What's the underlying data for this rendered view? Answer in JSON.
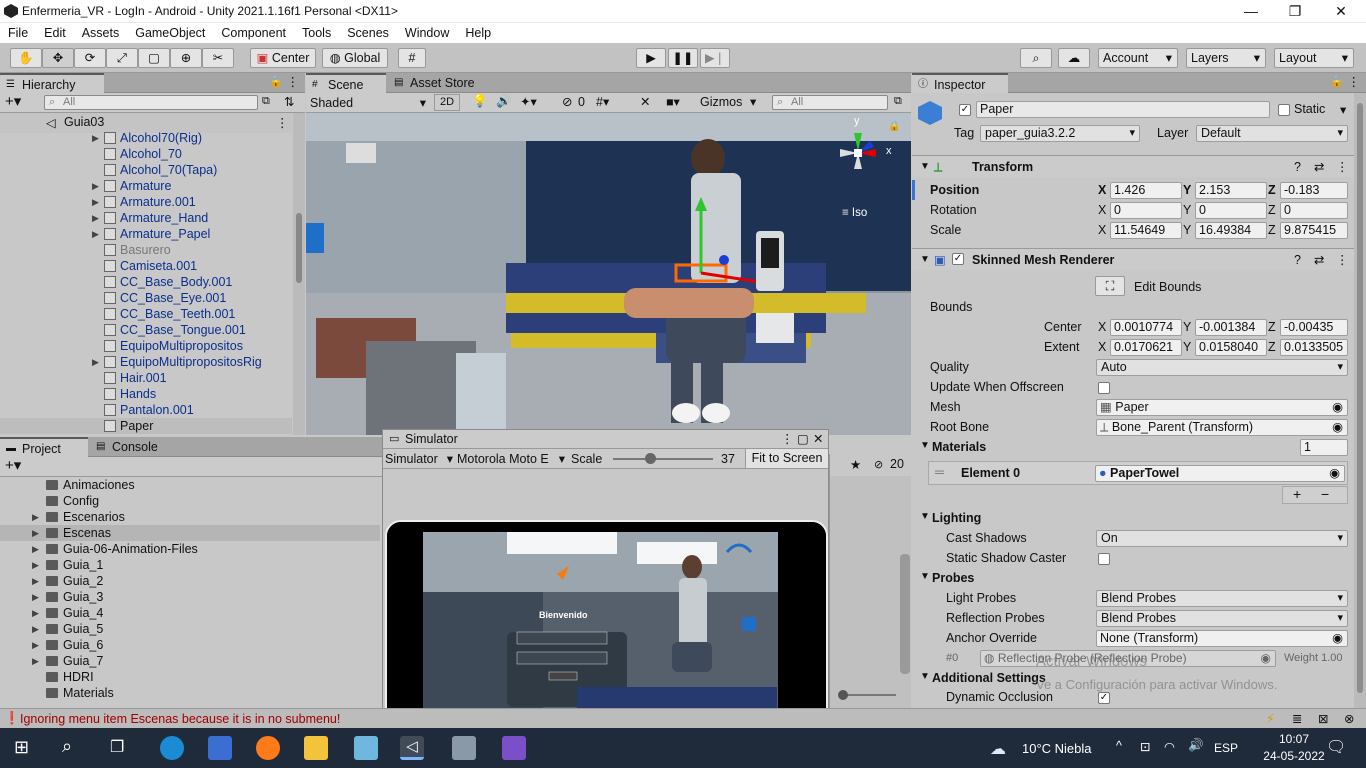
{
  "window": {
    "title": "Enfermeria_VR - LogIn - Android - Unity 2021.1.16f1 Personal <DX11>"
  },
  "menu": [
    "File",
    "Edit",
    "Assets",
    "GameObject",
    "Component",
    "Tools",
    "Scenes",
    "Window",
    "Help"
  ],
  "toolbar": {
    "center_label": "Center",
    "global_label": "Global",
    "account_label": "Account",
    "layers_label": "Layers",
    "layout_label": "Layout"
  },
  "hierarchy": {
    "tab": "Hierarchy",
    "search_placeholder": "All",
    "scene_name": "Guia03",
    "items": [
      {
        "label": "Alcohol70(Rig)",
        "expandable": true
      },
      {
        "label": "Alcohol_70",
        "expandable": false
      },
      {
        "label": "Alcohol_70(Tapa)",
        "expandable": false
      },
      {
        "label": "Armature",
        "expandable": true
      },
      {
        "label": "Armature.001",
        "expandable": true
      },
      {
        "label": "Armature_Hand",
        "expandable": true
      },
      {
        "label": "Armature_Papel",
        "expandable": true
      },
      {
        "label": "Basurero",
        "expandable": false
      },
      {
        "label": "Camiseta.001",
        "expandable": false
      },
      {
        "label": "CC_Base_Body.001",
        "expandable": false
      },
      {
        "label": "CC_Base_Eye.001",
        "expandable": false
      },
      {
        "label": "CC_Base_Teeth.001",
        "expandable": false
      },
      {
        "label": "CC_Base_Tongue.001",
        "expandable": false
      },
      {
        "label": "EquipoMultipropositos",
        "expandable": false
      },
      {
        "label": "EquipoMultipropositosRig",
        "expandable": true
      },
      {
        "label": "Hair.001",
        "expandable": false
      },
      {
        "label": "Hands",
        "expandable": false
      },
      {
        "label": "Pantalon.001",
        "expandable": false
      },
      {
        "label": "Paper",
        "expandable": false
      }
    ]
  },
  "scene": {
    "tab_scene": "Scene",
    "tab_store": "Asset Store",
    "shading": "Shaded",
    "mode_2d": "2D",
    "hidden_count": "0",
    "gizmos": "Gizmos",
    "search_placeholder": "All",
    "iso_label": "Iso",
    "gizmo_y": "y",
    "gizmo_x": "x"
  },
  "inspector": {
    "tab": "Inspector",
    "object_name": "Paper",
    "static_label": "Static",
    "tag_label": "Tag",
    "tag_value": "paper_guia3.2.2",
    "layer_label": "Layer",
    "layer_value": "Default",
    "transform": {
      "title": "Transform",
      "position_label": "Position",
      "rotation_label": "Rotation",
      "scale_label": "Scale",
      "position": {
        "x": "1.426",
        "y": "2.153",
        "z": "-0.183"
      },
      "rotation": {
        "x": "0",
        "y": "0",
        "z": "0"
      },
      "scale": {
        "x": "11.54649",
        "y": "16.49384",
        "z": "9.875415"
      }
    },
    "smr": {
      "title": "Skinned Mesh Renderer",
      "edit_bounds": "Edit Bounds",
      "bounds_label": "Bounds",
      "center_label": "Center",
      "extent_label": "Extent",
      "center": {
        "x": "0.0010774",
        "y": "-0.001384",
        "z": "-0.00435"
      },
      "extent": {
        "x": "0.0170621",
        "y": "0.0158040",
        "z": "0.0133505"
      },
      "quality_label": "Quality",
      "quality_value": "Auto",
      "update_offscreen_label": "Update When Offscreen",
      "mesh_label": "Mesh",
      "mesh_value": "Paper",
      "root_bone_label": "Root Bone",
      "root_bone_value": "Bone_Parent (Transform)",
      "materials_label": "Materials",
      "materials_count": "1",
      "element0_label": "Element 0",
      "element0_value": "PaperTowel",
      "lighting_label": "Lighting",
      "cast_shadows_label": "Cast Shadows",
      "cast_shadows_value": "On",
      "static_shadow_label": "Static Shadow Caster",
      "probes_label": "Probes",
      "light_probes_label": "Light Probes",
      "light_probes_value": "Blend Probes",
      "reflection_probes_label": "Reflection Probes",
      "reflection_probes_value": "Blend Probes",
      "anchor_override_label": "Anchor Override",
      "anchor_override_value": "None (Transform)",
      "probe_index": "#0",
      "probe_entry": "Reflection Probe (Reflection Probe)",
      "probe_weight": "Weight 1.00",
      "additional_label": "Additional Settings",
      "dynamic_occlusion_label": "Dynamic Occlusion"
    },
    "watermark_1": "Activar Windows",
    "watermark_2": "Ve a Configuración para activar Windows."
  },
  "project": {
    "tab_project": "Project",
    "tab_console": "Console",
    "items": [
      {
        "label": "Animaciones",
        "expandable": false
      },
      {
        "label": "Config",
        "expandable": false
      },
      {
        "label": "Escenarios",
        "expandable": true
      },
      {
        "label": "Escenas",
        "expandable": true
      },
      {
        "label": "Guia-06-Animation-Files",
        "expandable": true
      },
      {
        "label": "Guia_1",
        "expandable": true
      },
      {
        "label": "Guia_2",
        "expandable": true
      },
      {
        "label": "Guia_3",
        "expandable": true
      },
      {
        "label": "Guia_4",
        "expandable": true
      },
      {
        "label": "Guia_5",
        "expandable": true
      },
      {
        "label": "Guia_6",
        "expandable": true
      },
      {
        "label": "Guia_7",
        "expandable": true
      },
      {
        "label": "HDRI",
        "expandable": false
      },
      {
        "label": "Materials",
        "expandable": false
      }
    ],
    "hidden_badge": "20"
  },
  "simulator": {
    "tab": "Simulator",
    "mode": "Simulator",
    "device": "Motorola Moto E",
    "scale_label": "Scale",
    "scale_value": "37",
    "scale_level": 0.37,
    "fit_label": "Fit to Screen",
    "welcome": "Bienvenido"
  },
  "status": {
    "message": "Ignoring menu item Escenas because it is in no submenu!"
  },
  "taskbar": {
    "weather": "10°C  Niebla",
    "lang": "ESP",
    "time": "10:07",
    "date": "24-05-2022"
  },
  "colors": {
    "accent_blue": "#0b2f8c",
    "error_red": "#cc0000",
    "taskbar": "#1f2a3a"
  }
}
